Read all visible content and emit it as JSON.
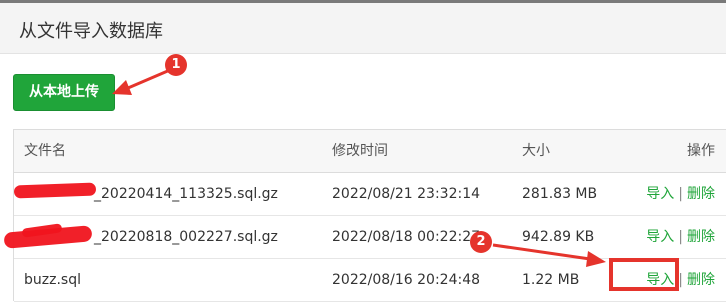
{
  "header": {
    "title": "从文件导入数据库"
  },
  "toolbar": {
    "upload_label": "从本地上传"
  },
  "table": {
    "columns": [
      "文件名",
      "修改时间",
      "大小",
      "操作"
    ],
    "rows": [
      {
        "name": "_20220414_113325.sql.gz",
        "time": "2022/08/21 23:32:14",
        "size": "281.83 MB",
        "import": "导入",
        "sep": "|",
        "delete": "删除"
      },
      {
        "name": "_20220818_002227.sql.gz",
        "time": "2022/08/18 00:22:27",
        "size": "942.89 KB",
        "import": "导入",
        "sep": "|",
        "delete": "删除"
      },
      {
        "name": "buzz.sql",
        "time": "2022/08/16 20:24:48",
        "size": "1.22 MB",
        "import": "导入",
        "sep": "|",
        "delete": "删除"
      }
    ]
  },
  "annotations": {
    "callout_1": "1",
    "callout_2": "2"
  },
  "colors": {
    "accent": "#20a53a",
    "annotation": "#e5342c"
  }
}
